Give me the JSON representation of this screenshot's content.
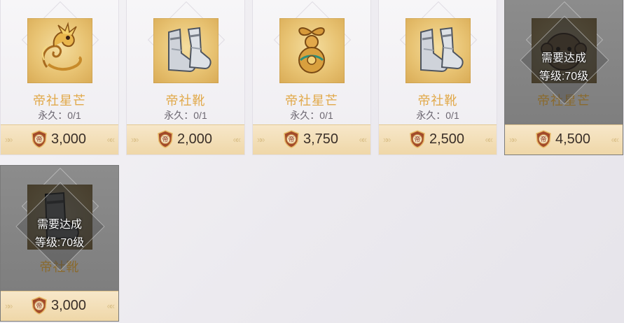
{
  "colors": {
    "item_name": "#e1a94a",
    "price_text": "#3a2f28",
    "price_bar": "#f3dfb7",
    "locked_overlay": "#7f7f7f"
  },
  "items": [
    {
      "name": "帝社星芒",
      "limit": "永久：0/1",
      "price": "3,000",
      "icon": "golden-dragon-icon",
      "locked": false,
      "requirement_line1": "",
      "requirement_line2": ""
    },
    {
      "name": "帝社靴",
      "limit": "永久：0/1",
      "price": "2,000",
      "icon": "silver-boots-icon",
      "locked": false,
      "requirement_line1": "",
      "requirement_line2": ""
    },
    {
      "name": "帝社星芒",
      "limit": "永久：0/1",
      "price": "3,750",
      "icon": "golden-gourd-icon",
      "locked": false,
      "requirement_line1": "",
      "requirement_line2": ""
    },
    {
      "name": "帝社靴",
      "limit": "永久：0/1",
      "price": "2,500",
      "icon": "silver-boots-icon",
      "locked": false,
      "requirement_line1": "",
      "requirement_line2": ""
    },
    {
      "name": "帝社星芒",
      "limit": "",
      "price": "4,500",
      "icon": "monkey-head-icon",
      "locked": true,
      "requirement_line1": "需要达成",
      "requirement_line2": "等级:70级"
    },
    {
      "name": "帝社靴",
      "limit": "",
      "price": "3,000",
      "icon": "dark-boots-icon",
      "locked": true,
      "requirement_line1": "需要达成",
      "requirement_line2": "等级:70级"
    }
  ],
  "currency_icon": "di-coin-icon",
  "currency_glyph": "帝"
}
